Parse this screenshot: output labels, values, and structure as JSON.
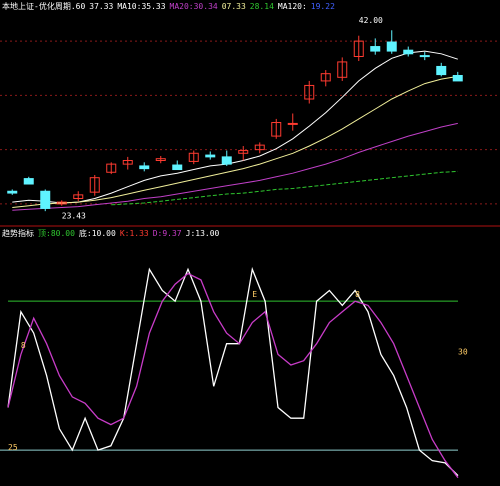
{
  "colors": {
    "background": "#000000",
    "up": "#ff3b30",
    "down": "#5ff3ff",
    "ma1": "#ffffff",
    "ma2": "#f0ee9a",
    "ma3": "#c040c8",
    "ma4": "#2fc82f",
    "grid": "#8a1a1a",
    "k": "#ffffff",
    "d": "#c83cc8",
    "band": "#2fbf2f",
    "ref": "#8fd0d0"
  },
  "top_legend": [
    {
      "text": "本地上证-优化周期.60",
      "color": "#ffffff"
    },
    {
      "text": "37.33",
      "color": "#ffffff"
    },
    {
      "text": "MA10:35.33",
      "color": "#ffffff"
    },
    {
      "text": "MA20:30.34",
      "color": "#c040c8"
    },
    {
      "text": "07.33",
      "color": "#f0ee9a"
    },
    {
      "text": "28.14",
      "color": "#2fc82f"
    },
    {
      "text": "MA120:",
      "color": "#ffffff"
    },
    {
      "text": "19.22",
      "color": "#4060ff"
    }
  ],
  "bottom_legend": [
    {
      "text": "趋势指标",
      "color": "#ffffff"
    },
    {
      "text": "顶:80.00",
      "color": "#2fc82f"
    },
    {
      "text": "底:10.00",
      "color": "#ffffff"
    },
    {
      "text": "K:1.33",
      "color": "#ff3b30"
    },
    {
      "text": "D:9.37",
      "color": "#c83cc8"
    },
    {
      "text": "J:13.00",
      "color": "#ffffff"
    }
  ],
  "chart_data": [
    {
      "type": "candlestick",
      "title": "本地上证-优化周期",
      "ylim": [
        22,
        45
      ],
      "grid": true,
      "candles": [
        {
          "o": 25.4,
          "h": 25.6,
          "l": 25.0,
          "c": 25.2
        },
        {
          "o": 26.8,
          "h": 27.0,
          "l": 26.5,
          "c": 26.2
        },
        {
          "o": 25.4,
          "h": 25.6,
          "l": 23.2,
          "c": 23.5
        },
        {
          "o": 24.0,
          "h": 24.4,
          "l": 23.8,
          "c": 24.2
        },
        {
          "o": 24.6,
          "h": 25.4,
          "l": 24.3,
          "c": 25.0
        },
        {
          "o": 25.3,
          "h": 27.2,
          "l": 24.9,
          "c": 26.9
        },
        {
          "o": 27.5,
          "h": 28.6,
          "l": 27.3,
          "c": 28.4
        },
        {
          "o": 28.4,
          "h": 29.2,
          "l": 27.8,
          "c": 28.8
        },
        {
          "o": 28.2,
          "h": 28.6,
          "l": 27.6,
          "c": 27.9
        },
        {
          "o": 28.8,
          "h": 29.3,
          "l": 28.5,
          "c": 29.0
        },
        {
          "o": 28.3,
          "h": 28.8,
          "l": 27.9,
          "c": 27.8
        },
        {
          "o": 28.7,
          "h": 29.9,
          "l": 28.4,
          "c": 29.6
        },
        {
          "o": 29.4,
          "h": 29.8,
          "l": 28.9,
          "c": 29.2
        },
        {
          "o": 29.2,
          "h": 29.9,
          "l": 28.2,
          "c": 28.4
        },
        {
          "o": 29.6,
          "h": 30.4,
          "l": 28.8,
          "c": 29.9
        },
        {
          "o": 30.0,
          "h": 30.8,
          "l": 29.6,
          "c": 30.5
        },
        {
          "o": 31.5,
          "h": 33.4,
          "l": 31.2,
          "c": 33.0
        },
        {
          "o": 32.8,
          "h": 34.0,
          "l": 32.1,
          "c": 32.9
        },
        {
          "o": 35.6,
          "h": 37.6,
          "l": 35.1,
          "c": 37.1
        },
        {
          "o": 37.6,
          "h": 38.8,
          "l": 37.0,
          "c": 38.4
        },
        {
          "o": 38.0,
          "h": 40.2,
          "l": 37.6,
          "c": 39.7
        },
        {
          "o": 40.3,
          "h": 42.6,
          "l": 39.8,
          "c": 42.0
        },
        {
          "o": 41.4,
          "h": 42.3,
          "l": 40.5,
          "c": 40.9
        },
        {
          "o": 41.9,
          "h": 43.2,
          "l": 40.6,
          "c": 40.9
        },
        {
          "o": 41.0,
          "h": 41.4,
          "l": 40.3,
          "c": 40.6
        },
        {
          "o": 40.4,
          "h": 40.8,
          "l": 39.9,
          "c": 40.3
        },
        {
          "o": 39.2,
          "h": 39.6,
          "l": 38.1,
          "c": 38.3
        },
        {
          "o": 38.2,
          "h": 38.6,
          "l": 37.6,
          "c": 37.6
        }
      ],
      "series": [
        {
          "values": [
            24.2,
            24.4,
            24.3,
            24.1,
            24.2,
            24.6,
            25.2,
            25.9,
            26.6,
            27.1,
            27.4,
            27.8,
            28.2,
            28.4,
            28.8,
            29.3,
            30.1,
            31.2,
            32.6,
            34.1,
            35.8,
            37.6,
            39.0,
            40.1,
            40.7,
            40.9,
            40.6,
            40.0
          ]
        },
        {
          "values": [
            23.6,
            23.8,
            24.0,
            24.1,
            24.2,
            24.4,
            24.7,
            25.1,
            25.5,
            25.9,
            26.3,
            26.7,
            27.1,
            27.5,
            27.9,
            28.4,
            29.0,
            29.6,
            30.4,
            31.3,
            32.3,
            33.4,
            34.5,
            35.6,
            36.5,
            37.3,
            37.8,
            38.1
          ]
        },
        {
          "values": [
            23.3,
            23.4,
            23.5,
            23.6,
            23.7,
            23.9,
            24.1,
            24.3,
            24.6,
            24.8,
            25.1,
            25.4,
            25.7,
            26.0,
            26.3,
            26.6,
            27.0,
            27.4,
            27.9,
            28.4,
            29.0,
            29.7,
            30.3,
            30.9,
            31.5,
            32.0,
            32.5,
            32.9
          ]
        },
        {
          "values": [
            null,
            null,
            null,
            null,
            null,
            null,
            23.9,
            24.0,
            24.1,
            24.3,
            24.5,
            24.7,
            24.9,
            25.1,
            25.2,
            25.4,
            25.6,
            25.7,
            25.9,
            26.1,
            26.3,
            26.5,
            26.7,
            26.9,
            27.1,
            27.3,
            27.5,
            27.6
          ]
        }
      ],
      "annotations": [
        {
          "text": "42.00",
          "x": 21,
          "y": 44.0
        },
        {
          "text": "23.43",
          "x": 3,
          "y": 22.4
        }
      ]
    },
    {
      "type": "line",
      "title": "趋势指标",
      "ylim": [
        -5,
        105
      ],
      "x": [
        0,
        1,
        2,
        3,
        4,
        5,
        6,
        7,
        8,
        9,
        10,
        11,
        12,
        13,
        14,
        15,
        16,
        17,
        18,
        19,
        20,
        21,
        22,
        23,
        24,
        25,
        26,
        27,
        28,
        29,
        30,
        31,
        32,
        33,
        34,
        35
      ],
      "series": [
        {
          "name": "K",
          "values": [
            30,
            75,
            65,
            45,
            20,
            10,
            25,
            10,
            12,
            25,
            60,
            95,
            85,
            80,
            95,
            80,
            40,
            60,
            60,
            95,
            80,
            30,
            25,
            25,
            80,
            85,
            78,
            85,
            75,
            55,
            45,
            30,
            10,
            5,
            4,
            -2
          ]
        },
        {
          "name": "D",
          "values": [
            30,
            55,
            72,
            60,
            45,
            35,
            32,
            25,
            22,
            25,
            40,
            65,
            80,
            88,
            93,
            90,
            75,
            65,
            60,
            70,
            75,
            55,
            50,
            52,
            60,
            70,
            75,
            80,
            78,
            70,
            60,
            45,
            30,
            15,
            5,
            -3
          ]
        }
      ],
      "levels": [
        {
          "name": "顶",
          "value": 80
        },
        {
          "name": "底",
          "value": 10
        }
      ],
      "markers": [
        {
          "text": "8",
          "x": 1,
          "y": 58
        },
        {
          "text": "8",
          "x": 27,
          "y": 82
        },
        {
          "text": "30",
          "x": 35,
          "y": 55
        },
        {
          "text": "25",
          "x": 0,
          "y": 10
        },
        {
          "text": "E",
          "x": 19,
          "y": 82
        }
      ]
    }
  ]
}
